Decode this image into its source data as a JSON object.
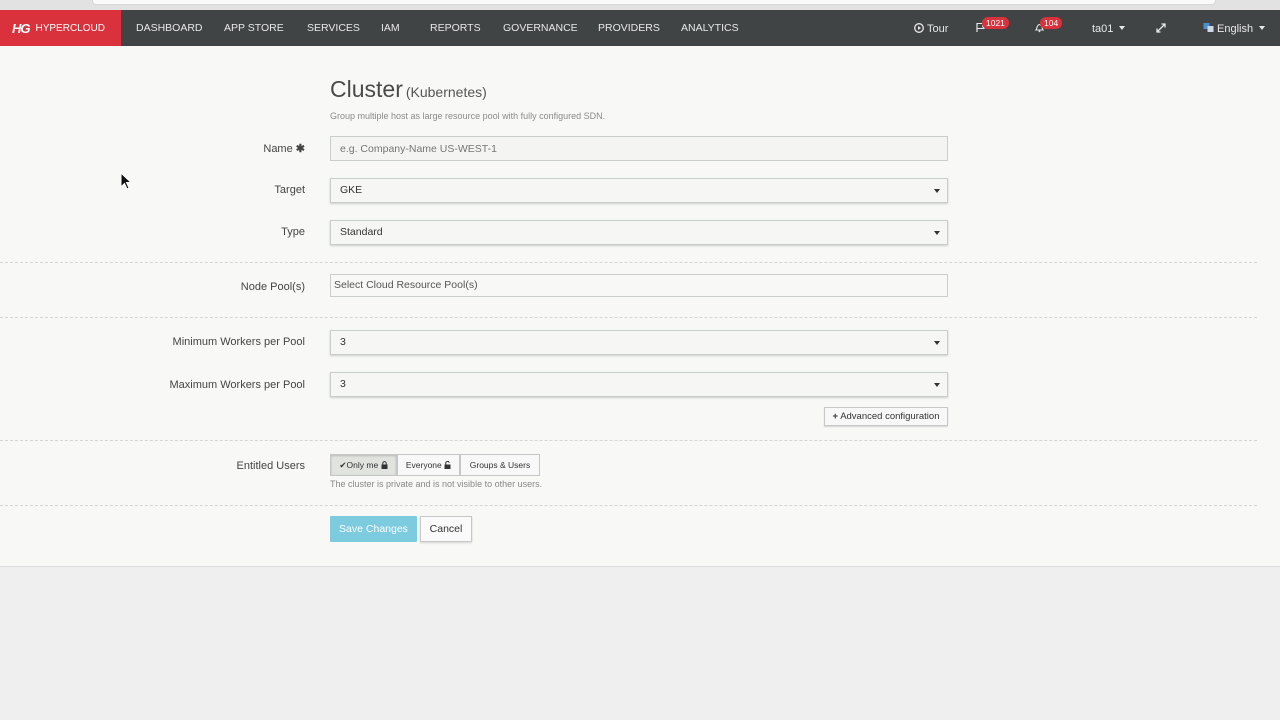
{
  "navbar": {
    "brand_logo": "HG",
    "brand_name": "HYPERCLOUD",
    "items": [
      "DASHBOARD",
      "APP STORE",
      "SERVICES",
      "IAM",
      "REPORTS",
      "GOVERNANCE",
      "PROVIDERS",
      "ANALYTICS"
    ],
    "tour_label": "Tour",
    "flag_count": "1021",
    "notification_count": "104",
    "user": "ta01",
    "language": "English"
  },
  "form": {
    "title": "Cluster",
    "title_suffix": "(Kubernetes)",
    "description": "Group multiple host as large resource pool with fully configured SDN.",
    "name_label": "Name",
    "name_placeholder": "e.g. Company-Name US-WEST-1",
    "target_label": "Target",
    "target_value": "GKE",
    "type_label": "Type",
    "type_value": "Standard",
    "node_pool_label": "Node Pool(s)",
    "node_pool_placeholder": "Select Cloud Resource Pool(s)",
    "min_workers_label": "Minimum Workers per Pool",
    "min_workers_value": "3",
    "max_workers_label": "Maximum Workers per Pool",
    "max_workers_value": "3",
    "advanced_label": "Advanced configuration",
    "entitled_label": "Entitled Users",
    "entitled_options": [
      "Only me",
      "Everyone",
      "Groups & Users"
    ],
    "entitled_selected": "Only me",
    "entitled_help": "The cluster is private and is not visible to other users.",
    "save_label": "Save Changes",
    "cancel_label": "Cancel"
  },
  "colors": {
    "nav_bg": "#404444",
    "brand_red": "#d9323c",
    "save_button": "#7ccbdf"
  }
}
